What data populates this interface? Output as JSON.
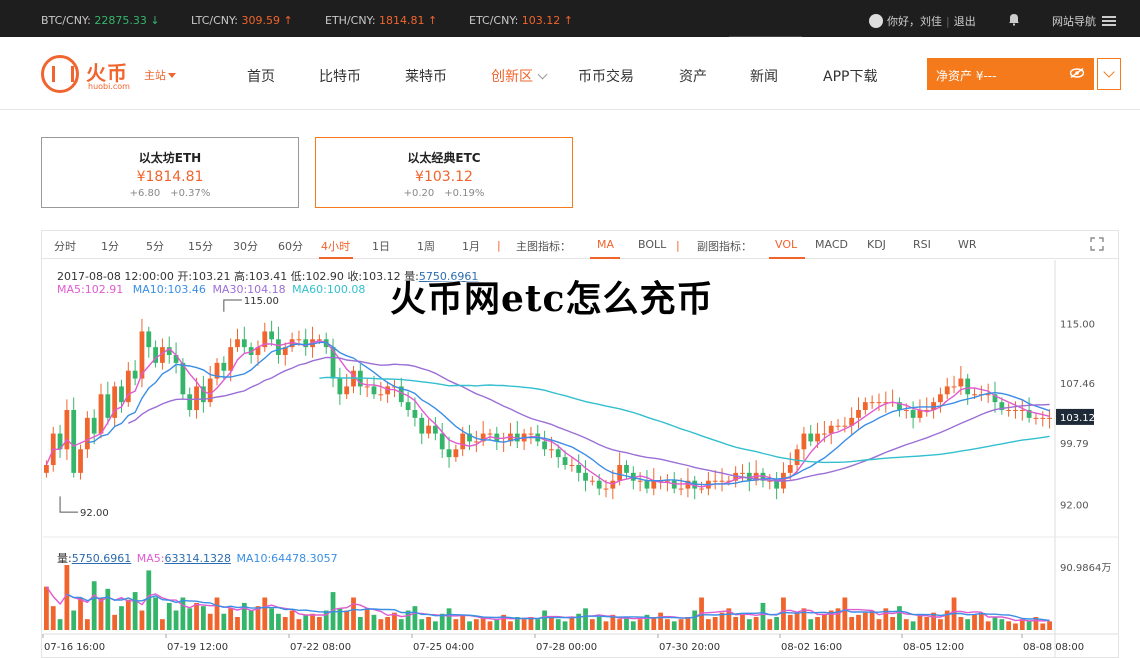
{
  "ticker": [
    {
      "label": "BTC/CNY:",
      "value": "22875.33",
      "arrow": "↓",
      "dir": "down"
    },
    {
      "label": "LTC/CNY:",
      "value": "309.59",
      "arrow": "↑",
      "dir": "up"
    },
    {
      "label": "ETH/CNY:",
      "value": "1814.81",
      "arrow": "↑",
      "dir": "up"
    },
    {
      "label": "ETC/CNY:",
      "value": "103.12",
      "arrow": "↑",
      "dir": "up"
    }
  ],
  "user": {
    "greeting": "你好，刘佳",
    "logout": "退出",
    "site_nav": "网站导航"
  },
  "logo": {
    "cn": "火币",
    "en": "huobi.com",
    "site": "主站"
  },
  "nav": {
    "items": [
      "首页",
      "比特币",
      "莱特币",
      "创新区",
      "币币交易",
      "资产",
      "新闻",
      "APP下载"
    ],
    "active_index": 3,
    "asset_label": "净资产 ¥---"
  },
  "cards": [
    {
      "title": "以太坊ETH",
      "price": "¥1814.81",
      "change": "+6.80",
      "pct": "+0.37%"
    },
    {
      "title": "以太经典ETC",
      "price": "¥103.12",
      "change": "+0.20",
      "pct": "+0.19%"
    }
  ],
  "toolbar": {
    "periods": [
      "分时",
      "1分",
      "5分",
      "15分",
      "30分",
      "60分",
      "4小时",
      "1日",
      "1周",
      "1月"
    ],
    "active_period": "4小时",
    "main_label": "主图指标：",
    "main_indicators": [
      "MA",
      "BOLL"
    ],
    "active_main": "MA",
    "sub_label": "副图指标：",
    "sub_indicators": [
      "VOL",
      "MACD",
      "KDJ",
      "RSI",
      "WR"
    ],
    "active_sub": "VOL"
  },
  "headline": "火币网etc怎么充币",
  "info": {
    "line1_time": "2017-08-08 12:00:00",
    "open": "开:103.21",
    "high": "高:103.41",
    "low": "低:102.90",
    "close": "收:103.12",
    "vol_lbl": "量:",
    "vol": "5750.6961",
    "ma5": "MA5:102.91",
    "ma10": "MA10:103.46",
    "ma30": "MA30:104.18",
    "ma60": "MA60:100.08",
    "vol_line_lbl": "量:",
    "vol_line_val": "5750.6961",
    "vma5_lbl": "MA5:",
    "vma5_val": "63314.1328",
    "vma10": "MA10:64478.3057"
  },
  "chart_data": {
    "type": "candlestick",
    "price_ticks": [
      "115.00",
      "107.46",
      "99.79",
      "92.00"
    ],
    "current_price": "103.12",
    "vol_tick": "90.9864万",
    "x_labels": [
      "07-16 16:00",
      "07-19 12:00",
      "07-22 08:00",
      "07-25 04:00",
      "07-28 00:00",
      "07-30 20:00",
      "08-02 16:00",
      "08-05 12:00",
      "08-08 08:00"
    ],
    "annot_high": "115.00",
    "annot_low": "92.00",
    "ylim": [
      90,
      118
    ],
    "close": [
      97,
      101,
      99,
      104,
      96,
      99,
      103,
      101,
      106,
      103,
      107,
      105,
      109,
      108,
      114,
      112,
      110,
      112,
      111,
      110,
      106,
      104,
      107,
      105,
      108,
      110,
      109,
      112,
      113,
      112,
      111,
      112,
      114,
      113,
      111,
      112,
      113,
      113,
      112,
      113,
      113,
      112,
      108,
      106,
      107,
      109,
      107,
      107,
      106,
      106,
      107,
      107,
      105,
      104,
      103,
      101,
      102,
      101,
      99,
      98,
      99,
      101,
      100,
      100,
      101,
      101,
      100,
      100,
      101,
      100,
      101,
      101,
      100,
      99,
      99,
      98,
      97,
      97,
      96,
      95,
      95,
      94,
      94,
      95,
      97,
      96,
      95,
      95,
      94,
      95,
      95,
      95,
      94,
      94,
      95,
      94,
      94,
      95,
      95,
      95,
      95,
      96,
      96,
      95,
      96,
      95,
      95,
      94,
      96,
      97,
      99,
      101,
      100,
      101,
      101,
      102,
      102,
      102,
      103,
      104,
      105,
      105,
      105,
      105,
      105,
      104,
      104,
      103,
      104,
      104,
      105,
      106,
      107,
      107,
      108,
      106,
      106,
      106,
      106,
      105,
      104,
      104,
      104,
      104,
      103,
      103,
      103,
      103
    ],
    "volume": [
      40,
      22,
      10,
      60,
      18,
      30,
      10,
      45,
      30,
      38,
      14,
      22,
      28,
      35,
      18,
      55,
      30,
      10,
      25,
      18,
      30,
      20,
      25,
      22,
      15,
      30,
      15,
      20,
      12,
      25,
      18,
      22,
      30,
      20,
      15,
      12,
      18,
      10,
      14,
      15,
      12,
      18,
      35,
      20,
      18,
      30,
      12,
      20,
      14,
      10,
      12,
      16,
      10,
      18,
      22,
      10,
      12,
      8,
      15,
      20,
      10,
      14,
      8,
      10,
      12,
      8,
      10,
      14,
      8,
      12,
      10,
      12,
      10,
      18,
      12,
      10,
      8,
      12,
      15,
      20,
      10,
      12,
      8,
      14,
      10,
      12,
      8,
      10,
      14,
      12,
      16,
      10,
      8,
      10,
      12,
      18,
      30,
      10,
      12,
      16,
      20,
      12,
      14,
      10,
      12,
      25,
      10,
      12,
      30,
      14,
      16,
      20,
      10,
      12,
      14,
      18,
      20,
      30,
      12,
      14,
      16,
      18,
      10,
      20,
      12,
      22,
      10,
      8,
      14,
      12,
      16,
      10,
      18,
      30,
      12,
      10,
      14,
      16,
      8,
      12,
      10,
      8,
      6,
      10,
      8,
      12,
      6,
      8
    ]
  }
}
